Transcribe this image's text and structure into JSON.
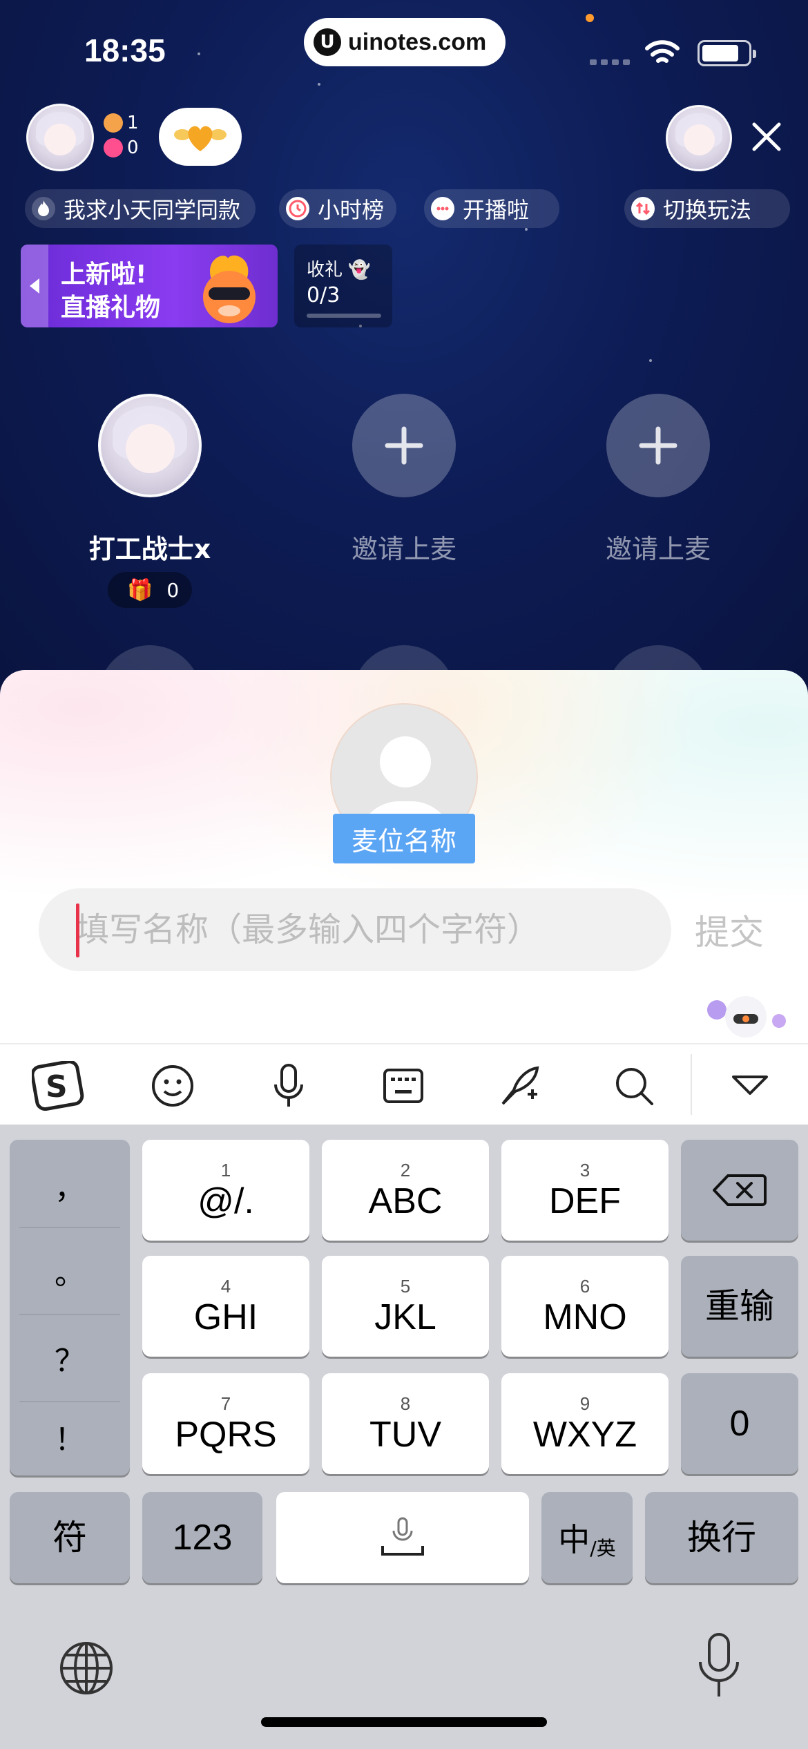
{
  "status_bar": {
    "time": "18:35",
    "url": "uinotes.com"
  },
  "header": {
    "audience_count": "1",
    "like_count": "0"
  },
  "tags": [
    {
      "label": "我求小天同学同款",
      "icon": "fire-icon",
      "color": "#ffffff"
    },
    {
      "label": "小时榜",
      "icon": "clock-icon",
      "color": "#ff5b6b"
    },
    {
      "label": "开播啦",
      "icon": "chat-icon",
      "color": "#ff5b6b"
    },
    {
      "label": "切换玩法",
      "icon": "switch-icon",
      "color": "#ff5b6b"
    }
  ],
  "promo": {
    "line1": "上新啦!",
    "line2": "直播礼物"
  },
  "gift_task": {
    "title": "收礼",
    "progress": "0/3",
    "progress_fraction": 0
  },
  "seats": [
    {
      "name": "打工战士x",
      "gifts": "0"
    },
    {
      "name": "邀请上麦"
    },
    {
      "name": "邀请上麦"
    }
  ],
  "sheet": {
    "badge": "麦位名称",
    "input_placeholder": "填写名称（最多输入四个字符）",
    "input_value": "",
    "submit": "提交"
  },
  "keyboard": {
    "punct": [
      "，",
      "。",
      "？",
      "！"
    ],
    "keys": [
      {
        "num": "1",
        "label": "@/."
      },
      {
        "num": "2",
        "label": "ABC"
      },
      {
        "num": "3",
        "label": "DEF"
      },
      {
        "num": "4",
        "label": "GHI"
      },
      {
        "num": "5",
        "label": "JKL"
      },
      {
        "num": "6",
        "label": "MNO"
      },
      {
        "num": "7",
        "label": "PQRS"
      },
      {
        "num": "8",
        "label": "TUV"
      },
      {
        "num": "9",
        "label": "WXYZ"
      }
    ],
    "reinput": "重输",
    "zero": "0",
    "symbols": "符",
    "numbers": "123",
    "lang_main": "中",
    "lang_sub": "/英",
    "newline": "换行"
  }
}
